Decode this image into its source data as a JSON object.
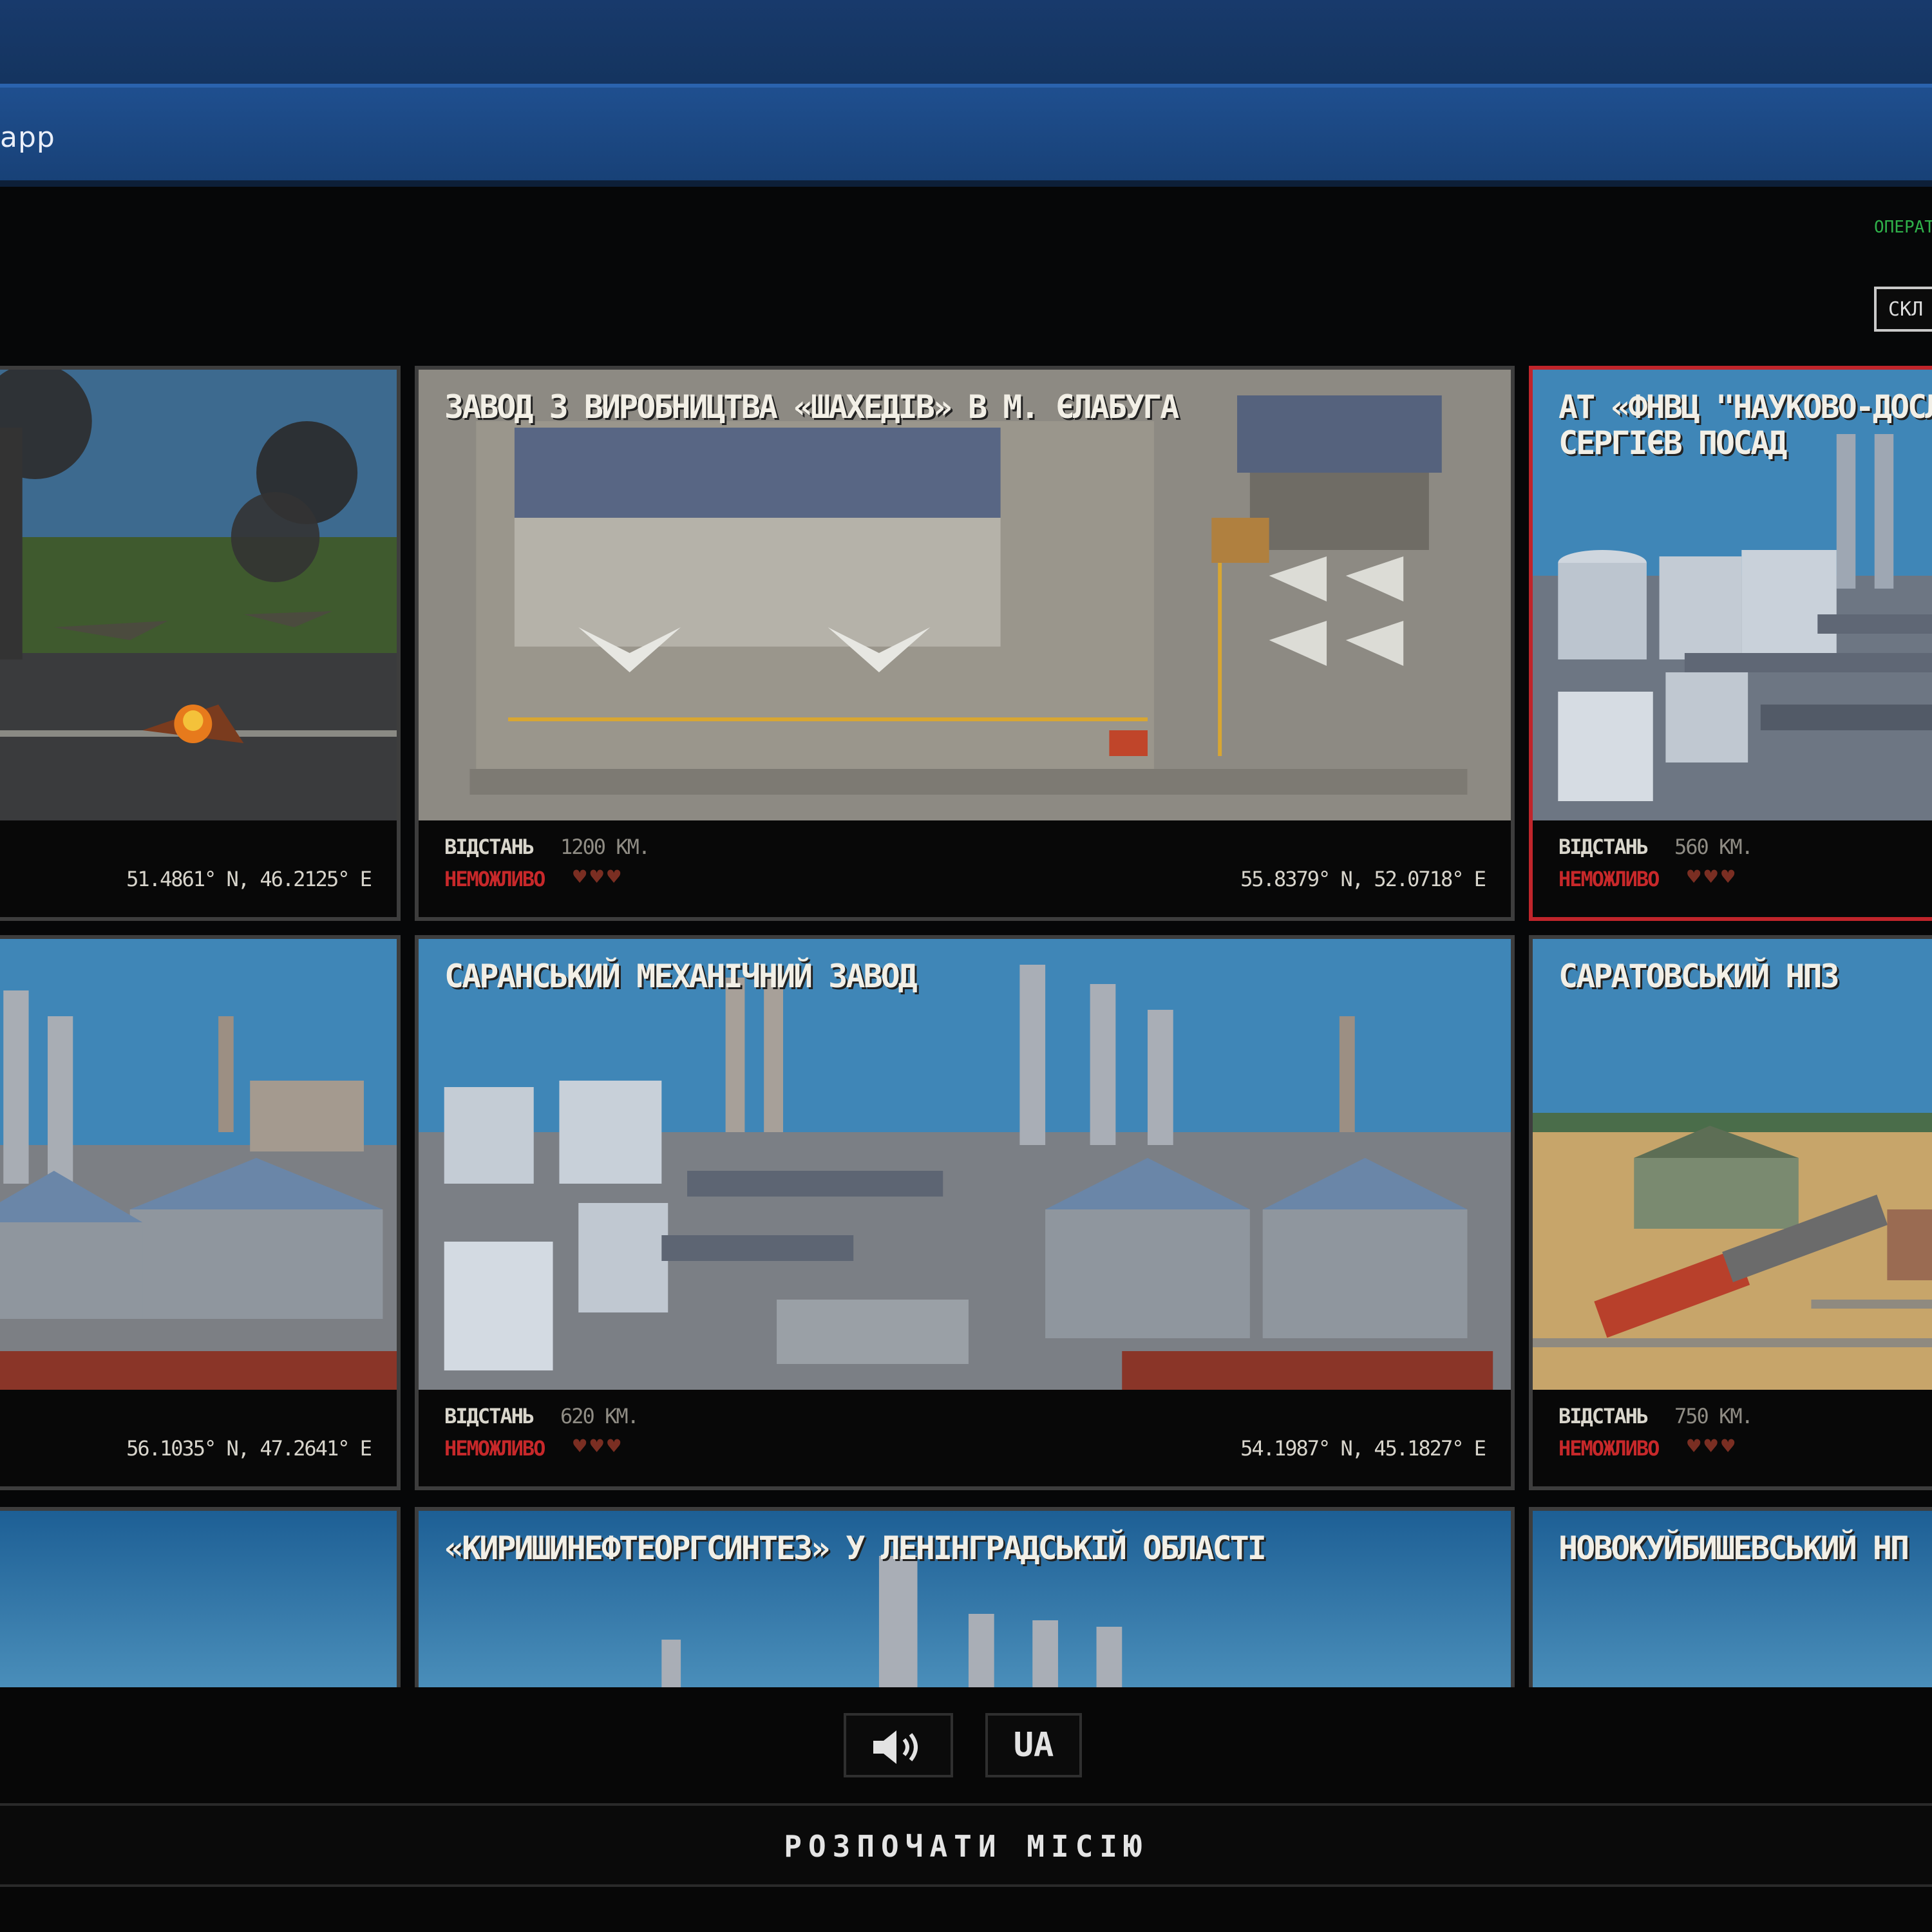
{
  "window": {
    "title": "app",
    "status_text": "ОПЕРАТИВНО",
    "top_button_label": "СКЛ"
  },
  "cards": [
    {
      "title": "",
      "distance_label": "",
      "distance_value": "",
      "status": "",
      "coords": "51.4861° N, 46.2125° E"
    },
    {
      "title": "ЗАВОД З ВИРОБНИЦТВА «ШАХЕДІВ» В М. ЄЛАБУГА",
      "distance_label": "ВІДСТАНЬ",
      "distance_value": "1200 КМ.",
      "status": "НЕМОЖЛИВО",
      "coords": "55.8379° N, 52.0718° E"
    },
    {
      "title": "АТ «ФНВЦ \"НАУКОВО-ДОСЛІ СЕРГІЄВ ПОСАД",
      "distance_label": "ВІДСТАНЬ",
      "distance_value": "560 КМ.",
      "status": "НЕМОЖЛИВО",
      "coords": ""
    },
    {
      "title": "",
      "distance_label": "",
      "distance_value": "",
      "status": "",
      "coords": "56.1035° N, 47.2641° E"
    },
    {
      "title": "САРАНСЬКИЙ МЕХАНІЧНИЙ ЗАВОД",
      "distance_label": "ВІДСТАНЬ",
      "distance_value": "620 КМ.",
      "status": "НЕМОЖЛИВО",
      "coords": "54.1987° N, 45.1827° E"
    },
    {
      "title": "САРАТОВСЬКИЙ НПЗ",
      "distance_label": "ВІДСТАНЬ",
      "distance_value": "750 КМ.",
      "status": "НЕМОЖЛИВО",
      "coords": ""
    },
    {
      "title": "",
      "distance_label": "",
      "distance_value": "",
      "status": "",
      "coords": ""
    },
    {
      "title": "«КИРИШИНЕФТЕОРГСИНТЕЗ» У ЛЕНІНГРАДСЬКІЙ ОБЛАСТІ",
      "distance_label": "",
      "distance_value": "",
      "status": "",
      "coords": ""
    },
    {
      "title": "НОВОКУЙБИШЕВСЬКИЙ НП",
      "distance_label": "",
      "distance_value": "",
      "status": "",
      "coords": ""
    }
  ],
  "footer": {
    "sound_icon": "speaker-icon",
    "language_label": "UA",
    "start_label": "РОЗПОЧАТИ МІСІЮ"
  },
  "colors": {
    "accent_red": "#c0252b",
    "header_blue": "#1f4f8f",
    "status_green": "#2fb04a"
  }
}
